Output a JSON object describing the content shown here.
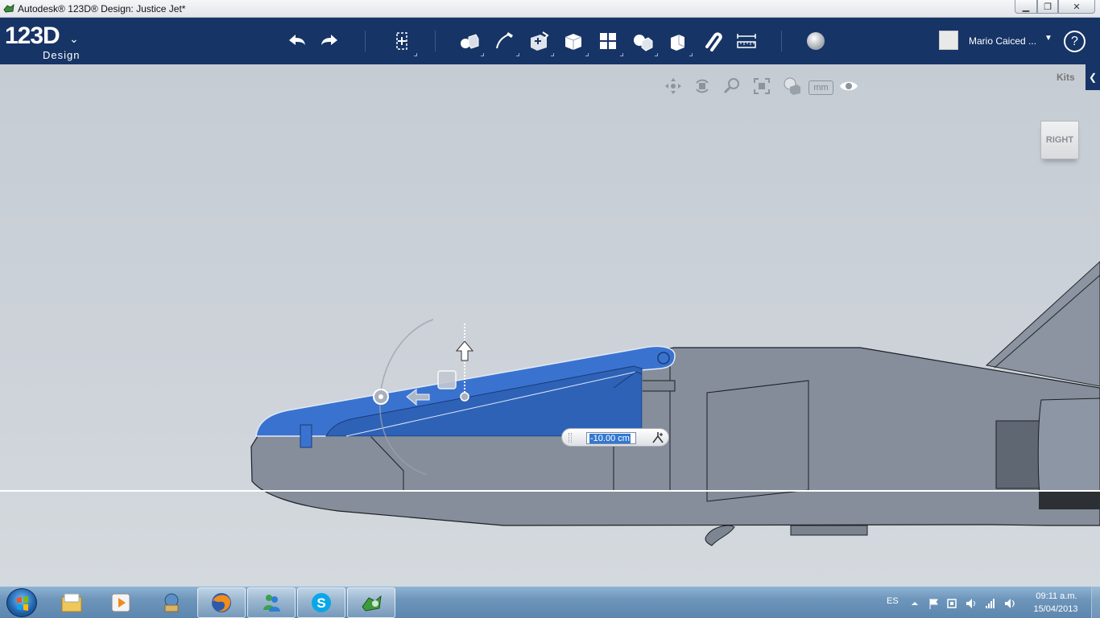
{
  "window": {
    "title": "Autodesk® 123D® Design: Justice Jet*",
    "minimize": "▁",
    "maximize": "❐",
    "close": "✕"
  },
  "logo": {
    "main": "123D",
    "sub": "Design",
    "caret": "⌄"
  },
  "toolbar": {
    "tools": [
      "undo-icon",
      "redo-icon",
      "transform-icon",
      "primitives-icon",
      "sketch-icon",
      "construct-icon",
      "modify-icon",
      "pattern-icon",
      "grouping-icon",
      "combine-icon",
      "snap-icon",
      "measure-icon",
      "material-icon"
    ]
  },
  "user": {
    "name": "Mario Caiced ...",
    "dropdown": "▼"
  },
  "help": {
    "label": "?"
  },
  "viewport": {
    "units": "mm",
    "kits_label": "Kits",
    "kits_toggle": "❮",
    "viewcube_face": "RIGHT"
  },
  "value_input": {
    "value": "-10.00 cm"
  },
  "colors": {
    "toolbar": "#163466",
    "selection": "#3a73cf",
    "body": "#848d99",
    "viewport": "#c9d0d7"
  },
  "taskbar": {
    "apps": [
      "explorer-icon",
      "media-player-icon",
      "program-icon",
      "firefox-icon",
      "messenger-icon",
      "skype-icon",
      "123d-design-icon"
    ],
    "language": "ES",
    "time": "09:11 a.m.",
    "date": "15/04/2013"
  }
}
